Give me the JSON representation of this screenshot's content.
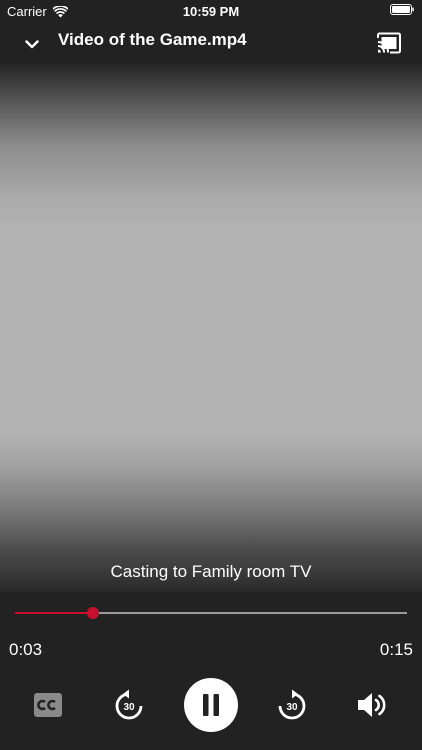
{
  "status_bar": {
    "carrier": "Carrier",
    "time": "10:59 PM"
  },
  "header": {
    "title": "Video of the Game.mp4"
  },
  "player": {
    "casting_text": "Casting to Family room TV",
    "current_time": "0:03",
    "total_time": "0:15",
    "progress_fraction": 0.2,
    "skip_back_seconds": "30",
    "skip_forward_seconds": "30",
    "state": "playing"
  },
  "colors": {
    "background": "#222222",
    "accent": "#c8102e",
    "track": "#9a9a9a"
  },
  "icons": {
    "collapse": "chevron-down-icon",
    "cast": "cast-icon",
    "captions": "closed-captions-icon",
    "rewind": "rewind-30-icon",
    "pause": "pause-icon",
    "forward": "forward-30-icon",
    "volume": "volume-icon"
  }
}
